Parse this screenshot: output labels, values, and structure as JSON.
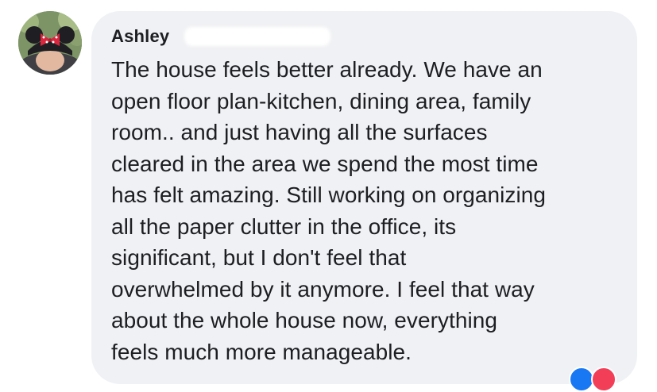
{
  "comment": {
    "author": "Ashley",
    "lines": [
      "The house feels better already. We have an",
      "open floor plan-kitchen, dining area, family",
      "room.. and just having all the surfaces",
      "cleared in the area we spend the most time",
      "has felt amazing. Still working on organizing",
      "all the paper clutter in the office, its",
      "significant, but I don't feel that",
      "overwhelmed by it anymore. I feel that way",
      "about the whole house now, everything",
      "feels much more manageable."
    ]
  },
  "colors": {
    "bubble_background": "#f0f1f4",
    "text": "#1c1e21",
    "reaction_like": "#1877f2",
    "reaction_love": "#f33e58"
  },
  "icons": {
    "avatar": "profile-photo",
    "reactions": [
      "like-reaction-icon",
      "love-reaction-icon"
    ]
  }
}
